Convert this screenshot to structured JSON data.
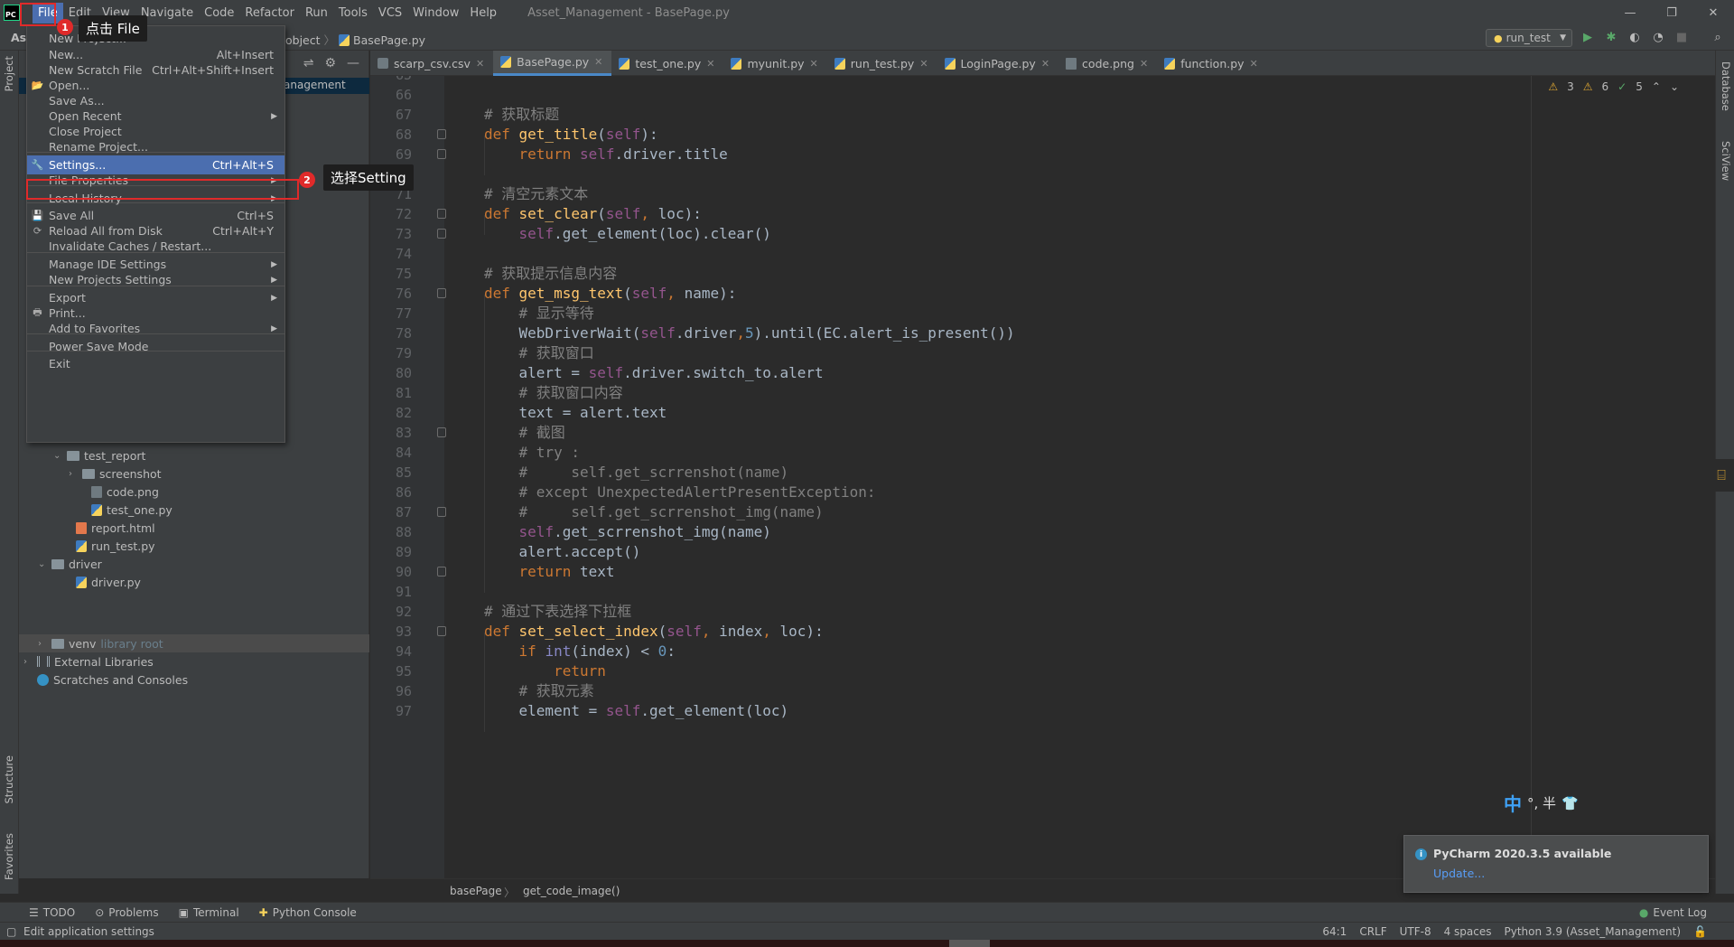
{
  "titlebar": {
    "logo_text": "PC",
    "menus": [
      "File",
      "Edit",
      "View",
      "Navigate",
      "Code",
      "Refactor",
      "Run",
      "Tools",
      "VCS",
      "Window",
      "Help"
    ],
    "title": "Asset_Management - BasePage.py"
  },
  "navbar": {
    "project_abbrev": "Ass",
    "crumb_parent": "object",
    "crumb_file": "BasePage.py",
    "run_config": "run_test"
  },
  "left_strip": {
    "project": "Project",
    "structure": "Structure",
    "favorites": "Favorites"
  },
  "right_strip": {
    "database": "Database",
    "sciview": "SciView"
  },
  "project_panel": {
    "selected_suffix": "anagement",
    "tree": [
      {
        "label": "test_report"
      },
      {
        "label": "screenshot"
      },
      {
        "label": "code.png"
      },
      {
        "label": "test_one.py"
      },
      {
        "label": "report.html"
      },
      {
        "label": "run_test.py"
      },
      {
        "label": "driver"
      },
      {
        "label": "driver.py"
      },
      {
        "label": "venv",
        "hint": "library root"
      },
      {
        "label": "External Libraries"
      },
      {
        "label": "Scratches and Consoles"
      }
    ]
  },
  "file_menu": {
    "items": [
      {
        "label": "New Project...",
        "shortcut": ""
      },
      {
        "label": "New...",
        "shortcut": "Alt+Insert"
      },
      {
        "label": "New Scratch File",
        "shortcut": "Ctrl+Alt+Shift+Insert"
      },
      {
        "label": "Open...",
        "shortcut": ""
      },
      {
        "label": "Save As...",
        "shortcut": ""
      },
      {
        "label": "Open Recent",
        "shortcut": ""
      },
      {
        "label": "Close Project",
        "shortcut": ""
      },
      {
        "label": "Rename Project...",
        "shortcut": ""
      },
      {
        "label": "Settings...",
        "shortcut": "Ctrl+Alt+S"
      },
      {
        "label": "File Properties",
        "shortcut": ""
      },
      {
        "label": "Local History",
        "shortcut": ""
      },
      {
        "label": "Save All",
        "shortcut": "Ctrl+S"
      },
      {
        "label": "Reload All from Disk",
        "shortcut": "Ctrl+Alt+Y"
      },
      {
        "label": "Invalidate Caches / Restart...",
        "shortcut": ""
      },
      {
        "label": "Manage IDE Settings",
        "shortcut": ""
      },
      {
        "label": "New Projects Settings",
        "shortcut": ""
      },
      {
        "label": "Export",
        "shortcut": ""
      },
      {
        "label": "Print...",
        "shortcut": ""
      },
      {
        "label": "Add to Favorites",
        "shortcut": ""
      },
      {
        "label": "Power Save Mode",
        "shortcut": ""
      },
      {
        "label": "Exit",
        "shortcut": ""
      }
    ]
  },
  "annotations": {
    "step1_num": "1",
    "step1_text": "点击 File",
    "step2_num": "2",
    "step2_text": "选择Setting"
  },
  "tabs": [
    "scarp_csv.csv",
    "BasePage.py",
    "test_one.py",
    "myunit.py",
    "run_test.py",
    "LoginPage.py",
    "code.png",
    "function.py"
  ],
  "inspections": {
    "warnings": "3",
    "weak_warnings": "6",
    "typos": "5"
  },
  "editor": {
    "lines": [
      {
        "n": "65",
        "segs": []
      },
      {
        "n": "66",
        "segs": []
      },
      {
        "n": "67",
        "segs": [
          [
            "cm",
            "# 获取标题"
          ]
        ]
      },
      {
        "n": "68",
        "segs": [
          [
            "kw",
            "def "
          ],
          [
            "fn",
            "get_title"
          ],
          [
            "",
            "("
          ],
          [
            "self",
            "self"
          ],
          [
            "",
            "):"
          ]
        ]
      },
      {
        "n": "69",
        "segs": [
          [
            "",
            "    "
          ],
          [
            "kw",
            "return "
          ],
          [
            "self",
            "self"
          ],
          [
            "",
            ".driver.title"
          ]
        ]
      },
      {
        "n": "70",
        "segs": []
      },
      {
        "n": "71",
        "segs": [
          [
            "cm",
            "# 清空元素文本"
          ]
        ]
      },
      {
        "n": "72",
        "segs": [
          [
            "kw",
            "def "
          ],
          [
            "fn",
            "set_clear"
          ],
          [
            "",
            "("
          ],
          [
            "self",
            "self"
          ],
          [
            "kw",
            ", "
          ],
          [
            "",
            "loc):"
          ]
        ]
      },
      {
        "n": "73",
        "segs": [
          [
            "",
            "    "
          ],
          [
            "self",
            "self"
          ],
          [
            "",
            ".get_element(loc).clear()"
          ]
        ]
      },
      {
        "n": "74",
        "segs": []
      },
      {
        "n": "75",
        "segs": [
          [
            "cm",
            "# 获取提示信息内容"
          ]
        ]
      },
      {
        "n": "76",
        "segs": [
          [
            "kw",
            "def "
          ],
          [
            "fn",
            "get_msg_text"
          ],
          [
            "",
            "("
          ],
          [
            "self",
            "self"
          ],
          [
            "kw",
            ", "
          ],
          [
            "",
            "name):"
          ]
        ]
      },
      {
        "n": "77",
        "segs": [
          [
            "",
            "    "
          ],
          [
            "cm",
            "# 显示等待"
          ]
        ]
      },
      {
        "n": "78",
        "segs": [
          [
            "",
            "    WebDriverWait("
          ],
          [
            "self",
            "self"
          ],
          [
            "",
            ".driver"
          ],
          [
            "kw",
            ","
          ],
          [
            "num",
            "5"
          ],
          [
            "",
            ").until(EC.alert_is_present())"
          ]
        ]
      },
      {
        "n": "79",
        "segs": [
          [
            "",
            "    "
          ],
          [
            "cm",
            "# 获取窗口"
          ]
        ]
      },
      {
        "n": "80",
        "segs": [
          [
            "",
            "    alert = "
          ],
          [
            "self",
            "self"
          ],
          [
            "",
            ".driver.switch_to.alert"
          ]
        ]
      },
      {
        "n": "81",
        "segs": [
          [
            "",
            "    "
          ],
          [
            "cm",
            "# 获取窗口内容"
          ]
        ]
      },
      {
        "n": "82",
        "segs": [
          [
            "",
            "    text = alert.text"
          ]
        ]
      },
      {
        "n": "83",
        "segs": [
          [
            "",
            "    "
          ],
          [
            "cm",
            "# 截图"
          ]
        ]
      },
      {
        "n": "84",
        "segs": [
          [
            "",
            "    "
          ],
          [
            "cm",
            "# try :"
          ]
        ]
      },
      {
        "n": "85",
        "segs": [
          [
            "",
            "    "
          ],
          [
            "cm",
            "#     self.get_scrrenshot(name)"
          ]
        ]
      },
      {
        "n": "86",
        "segs": [
          [
            "",
            "    "
          ],
          [
            "cm",
            "# except UnexpectedAlertPresentException:"
          ]
        ]
      },
      {
        "n": "87",
        "segs": [
          [
            "",
            "    "
          ],
          [
            "cm",
            "#     self.get_scrrenshot_img(name)"
          ]
        ]
      },
      {
        "n": "88",
        "segs": [
          [
            "",
            "    "
          ],
          [
            "self",
            "self"
          ],
          [
            "",
            ".get_scrrenshot_img(name)"
          ]
        ]
      },
      {
        "n": "89",
        "segs": [
          [
            "",
            "    alert.accept()"
          ]
        ]
      },
      {
        "n": "90",
        "segs": [
          [
            "",
            "    "
          ],
          [
            "kw",
            "return "
          ],
          [
            "",
            "text"
          ]
        ]
      },
      {
        "n": "91",
        "segs": []
      },
      {
        "n": "92",
        "segs": [
          [
            "cm",
            "# 通过下表选择下拉框"
          ]
        ]
      },
      {
        "n": "93",
        "segs": [
          [
            "kw",
            "def "
          ],
          [
            "fn",
            "set_select_index"
          ],
          [
            "",
            "("
          ],
          [
            "self",
            "self"
          ],
          [
            "kw",
            ", "
          ],
          [
            "",
            "index"
          ],
          [
            "kw",
            ", "
          ],
          [
            "",
            "loc):"
          ]
        ]
      },
      {
        "n": "94",
        "segs": [
          [
            "",
            "    "
          ],
          [
            "kw",
            "if "
          ],
          [
            "builtin",
            "int"
          ],
          [
            "",
            "(index) < "
          ],
          [
            "num",
            "0"
          ],
          [
            "",
            ":"
          ]
        ]
      },
      {
        "n": "95",
        "segs": [
          [
            "",
            "        "
          ],
          [
            "kw",
            "return"
          ]
        ]
      },
      {
        "n": "96",
        "segs": [
          [
            "",
            "    "
          ],
          [
            "cm",
            "# 获取元素"
          ]
        ]
      },
      {
        "n": "97",
        "segs": [
          [
            "",
            "    element = "
          ],
          [
            "self",
            "self"
          ],
          [
            "",
            ".get_element(loc)"
          ]
        ]
      }
    ]
  },
  "breadcrumb": {
    "a": "basePage",
    "b": "get_code_image()"
  },
  "ime": {
    "zh": "中",
    "rest": "°, 半"
  },
  "notification": {
    "title": "PyCharm 2020.3.5 available",
    "link": "Update..."
  },
  "toolwindows": [
    "TODO",
    "Problems",
    "Terminal",
    "Python Console"
  ],
  "event_log": "Event Log",
  "status": {
    "message": "Edit application settings",
    "position": "64:1",
    "line_sep": "CRLF",
    "encoding": "UTF-8",
    "indent": "4 spaces",
    "interpreter": "Python 3.9 (Asset_Management)"
  }
}
